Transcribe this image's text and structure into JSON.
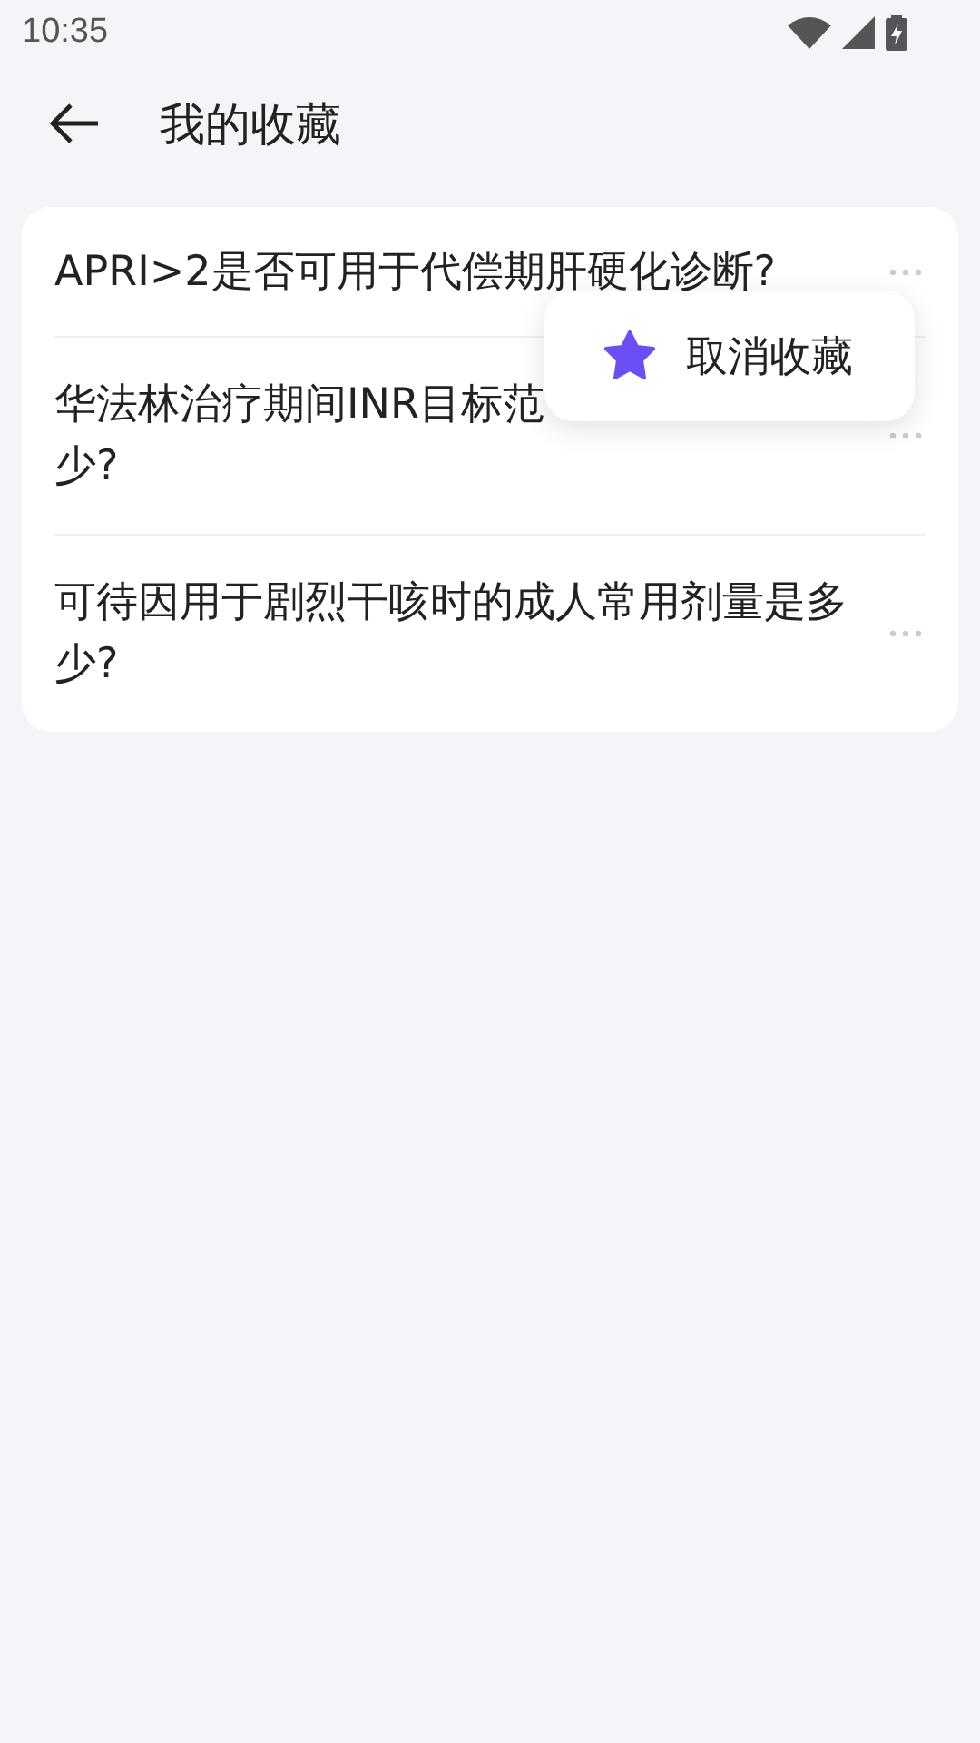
{
  "status_bar": {
    "time": "10:35"
  },
  "header": {
    "title": "我的收藏"
  },
  "favorites": [
    {
      "question": "APRI>2是否可用于代偿期肝硬化诊断?"
    },
    {
      "question": "华法林治疗期间INR目标范",
      "continued": "少?"
    },
    {
      "question": "可待因用于剧烈干咳时的成人常用剂量是多少?"
    }
  ],
  "popup_menu": {
    "items": [
      {
        "label": "取消收藏"
      }
    ]
  }
}
